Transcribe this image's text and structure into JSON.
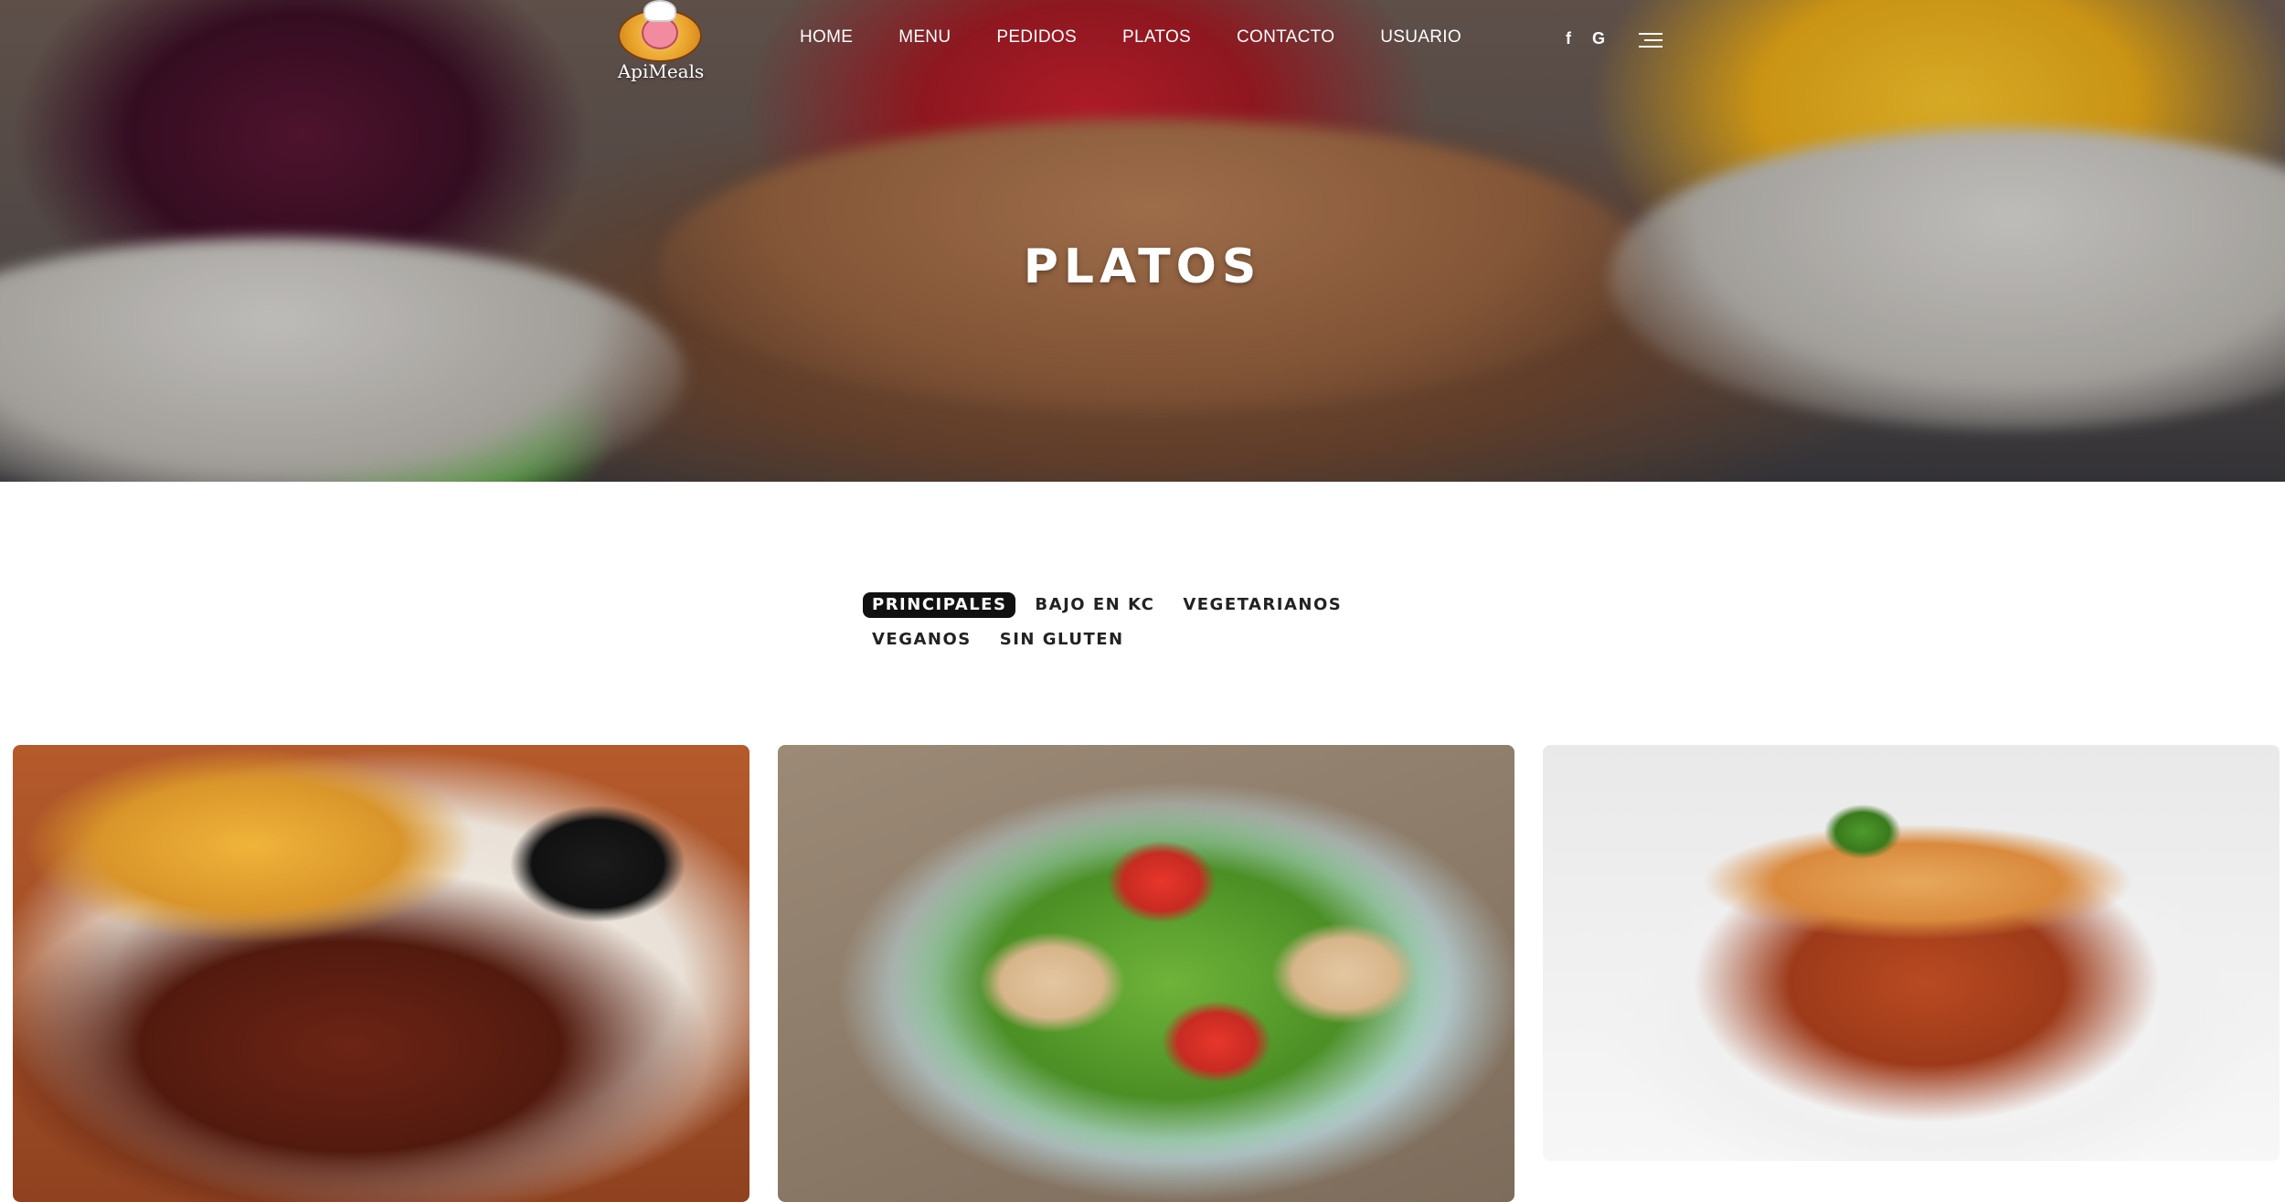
{
  "brand": {
    "logo_text": "ApiMeals"
  },
  "nav": {
    "items": [
      {
        "label": "HOME"
      },
      {
        "label": "MENU"
      },
      {
        "label": "PEDIDOS"
      },
      {
        "label": "PLATOS"
      },
      {
        "label": "CONTACTO"
      },
      {
        "label": "USUARIO"
      }
    ],
    "social": {
      "facebook_glyph": "f",
      "google_glyph": "G"
    },
    "menu_icon": "hamburger-icon"
  },
  "hero": {
    "title": "PLATOS"
  },
  "filters": {
    "items": [
      {
        "label": "PRINCIPALES",
        "active": true
      },
      {
        "label": "BAJO EN KC",
        "active": false
      },
      {
        "label": "VEGETARIANOS",
        "active": false
      },
      {
        "label": "VEGANOS",
        "active": false
      },
      {
        "label": "SIN GLUTEN",
        "active": false
      }
    ]
  },
  "cards": [
    {
      "image": "ribs-with-fries"
    },
    {
      "image": "chicken-salad"
    },
    {
      "image": "lasagna"
    }
  ],
  "colors": {
    "active_filter_bg": "#111111",
    "nav_text": "#ffffff"
  }
}
